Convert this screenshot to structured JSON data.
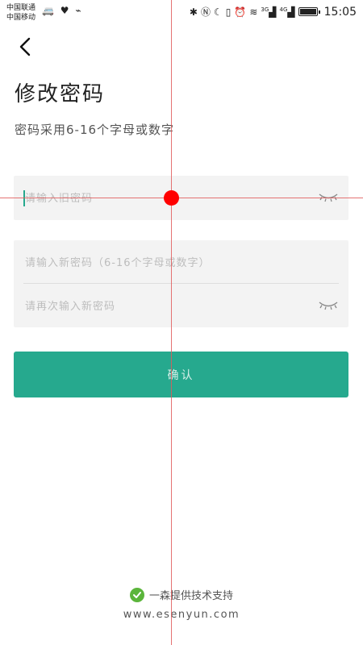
{
  "status_bar": {
    "carrier_1": "中国联通",
    "carrier_2": "中国移动",
    "left_icons": [
      "car-icon",
      "heart-rate-icon",
      "usb-icon"
    ],
    "right_icons": [
      "bluetooth-icon",
      "nfc-icon",
      "moon-icon",
      "vibrate-icon",
      "alarm-icon",
      "wifi-icon",
      "signal-3g-icon",
      "signal-4g-icon",
      "battery-icon"
    ],
    "net_3g": "3G",
    "net_4g": "4G",
    "time": "15:05"
  },
  "header": {
    "back_icon": "chevron-left-icon",
    "title": "修改密码",
    "subtitle": "密码采用6-16个字母或数字"
  },
  "form": {
    "old_password_placeholder": "请输入旧密码",
    "new_password_placeholder": "请输入新密码（6-16个字母或数字）",
    "confirm_password_placeholder": "请再次输入新密码",
    "eye_icon": "eye-closed-icon",
    "confirm_label": "确认"
  },
  "footer": {
    "support_text": "一森提供技术支持",
    "url": "www.esenyun.com",
    "check_icon": "check-circle-icon"
  },
  "colors": {
    "accent": "#26a98e",
    "field_bg": "#f3f3f3",
    "check_green": "#5bb53b",
    "overlay_red": "#ff0000"
  }
}
